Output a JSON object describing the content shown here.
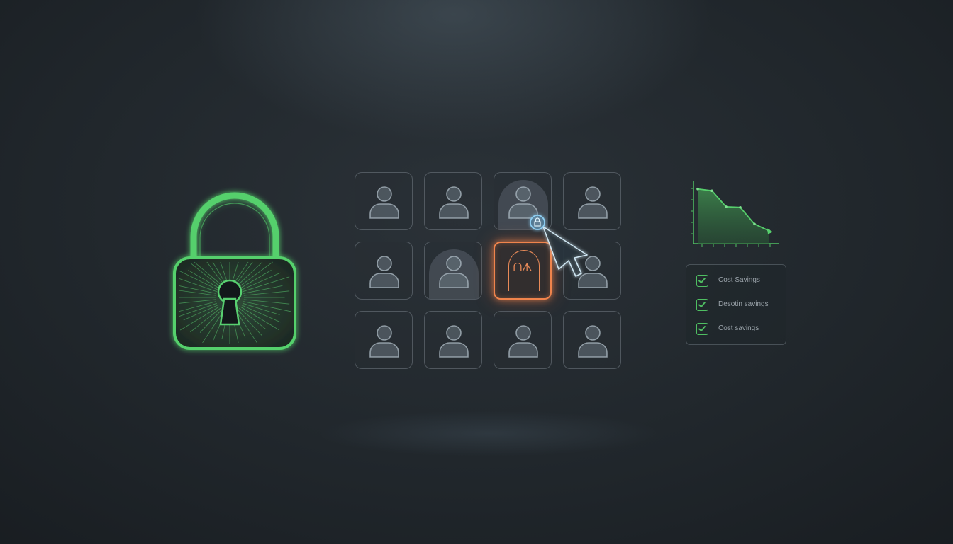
{
  "scene": {
    "accent_green": "#4fbf62",
    "accent_orange": "#f0844c",
    "accent_blue": "#8ecdf0",
    "background": "#1b1f23"
  },
  "lock": {
    "icon": "padlock-icon",
    "state": "locked"
  },
  "user_grid": {
    "rows": 3,
    "columns": 4,
    "tiles": [
      {
        "icon": "user-icon",
        "highlighted": false
      },
      {
        "icon": "user-icon",
        "highlighted": false
      },
      {
        "icon": "user-icon",
        "highlighted": true
      },
      {
        "icon": "user-icon",
        "highlighted": false
      },
      {
        "icon": "user-icon",
        "highlighted": false
      },
      {
        "icon": "user-icon",
        "highlighted": true
      },
      {
        "icon": "locked-door-icon",
        "selected": true,
        "glyph": "ᗩᗑ"
      },
      {
        "icon": "user-icon",
        "highlighted": false
      },
      {
        "icon": "user-icon",
        "highlighted": false
      },
      {
        "icon": "user-icon",
        "highlighted": false
      },
      {
        "icon": "user-icon",
        "highlighted": false
      },
      {
        "icon": "user-icon",
        "highlighted": false
      }
    ]
  },
  "pointer": {
    "icon": "cursor-arrow-icon",
    "badge_icon": "lock-icon"
  },
  "chart_data": {
    "type": "area",
    "title": "",
    "xlabel": "",
    "ylabel": "",
    "x": [
      1,
      2,
      3,
      4,
      5,
      6
    ],
    "values": [
      9.2,
      8.9,
      6.2,
      6.1,
      3.3,
      2.2
    ],
    "ylim": [
      0,
      10
    ],
    "grid": false,
    "trend_arrow": true
  },
  "checklist": {
    "items": [
      {
        "label": "Cost Savings",
        "checked": true
      },
      {
        "label": "Desotin savings",
        "checked": true
      },
      {
        "label": "Cost savings",
        "checked": true
      }
    ]
  }
}
